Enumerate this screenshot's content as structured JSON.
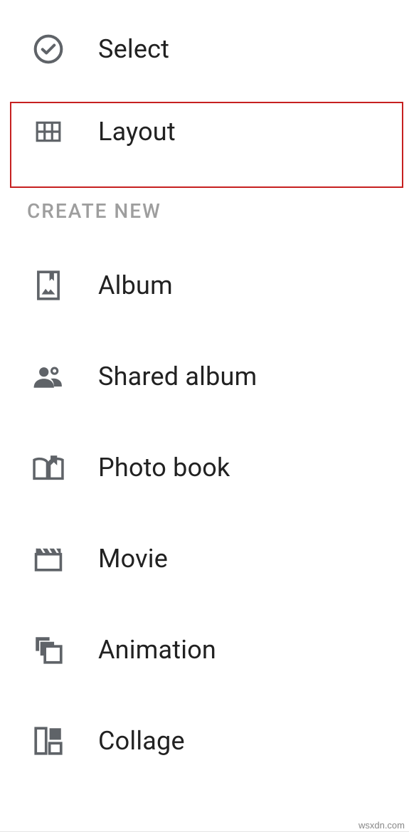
{
  "menu": {
    "top": [
      {
        "label": "Select"
      },
      {
        "label": "Layout"
      }
    ],
    "section_header": "CREATE NEW",
    "create": [
      {
        "label": "Album"
      },
      {
        "label": "Shared album"
      },
      {
        "label": "Photo book"
      },
      {
        "label": "Movie"
      },
      {
        "label": "Animation"
      },
      {
        "label": "Collage"
      }
    ]
  },
  "watermark": "wsxdn.com"
}
